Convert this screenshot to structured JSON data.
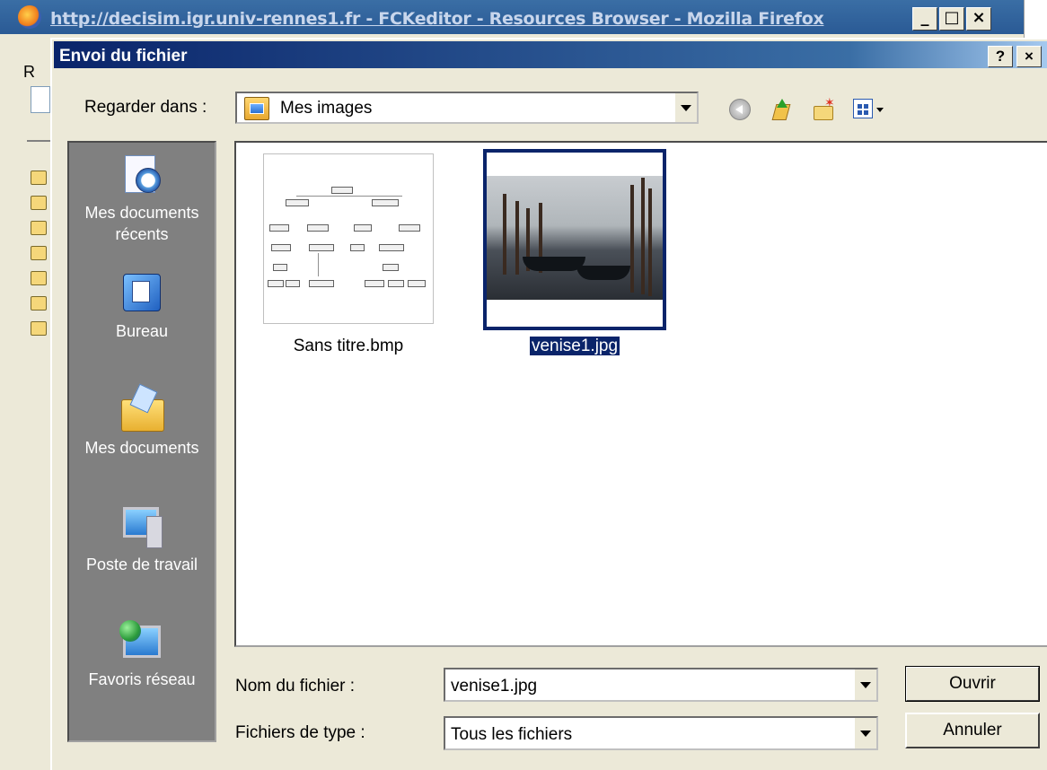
{
  "background_window": {
    "title": "http://decisim.igr.univ-rennes1.fr - FCKeditor - Resources Browser - Mozilla Firefox",
    "minimize_label": "_",
    "maximize_label": "□",
    "close_label": "×",
    "left_label": "R"
  },
  "dialog": {
    "title": "Envoi du fichier",
    "help_label": "?",
    "close_label": "×",
    "look_in_label": "Regarder dans :",
    "look_in_value": "Mes images",
    "places": [
      {
        "label": "Mes documents récents",
        "icon": "recent-documents-icon"
      },
      {
        "label": "Bureau",
        "icon": "desktop-icon"
      },
      {
        "label": "Mes documents",
        "icon": "my-documents-icon"
      },
      {
        "label": "Poste de travail",
        "icon": "my-computer-icon"
      },
      {
        "label": "Favoris réseau",
        "icon": "network-places-icon"
      }
    ],
    "files": [
      {
        "name": "Sans titre.bmp",
        "selected": false
      },
      {
        "name": "venise1.jpg",
        "selected": true
      }
    ],
    "filename_label": "Nom du fichier :",
    "filename_value": "venise1.jpg",
    "filetype_label": "Fichiers de type :",
    "filetype_value": "Tous les fichiers",
    "open_button": "Ouvrir",
    "cancel_button": "Annuler"
  },
  "colors": {
    "title_bar": "#0a246a",
    "selection": "#0a246a",
    "dialog_face": "#ece9d8",
    "places_bar": "#808080"
  }
}
